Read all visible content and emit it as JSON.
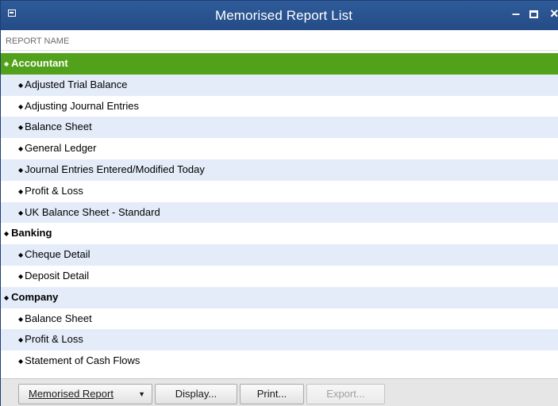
{
  "window": {
    "title": "Memorised Report List",
    "minimize_glyph": "–",
    "close_glyph": "×"
  },
  "list": {
    "column_header": "REPORT NAME",
    "groups": [
      {
        "name": "Accountant",
        "items": [
          "Adjusted Trial Balance",
          "Adjusting Journal Entries",
          "Balance Sheet",
          "General Ledger",
          "Journal Entries Entered/Modified Today",
          "Profit & Loss",
          "UK Balance Sheet - Standard"
        ]
      },
      {
        "name": "Banking",
        "items": [
          "Cheque Detail",
          "Deposit Detail"
        ]
      },
      {
        "name": "Company",
        "items": [
          "Balance Sheet",
          "Profit & Loss",
          "Statement of Cash Flows"
        ]
      }
    ],
    "bullet_glyph": "◆"
  },
  "footer": {
    "memorised_report": "Memorised Report",
    "memorised_report_arrow": "▼",
    "display": "Display...",
    "print": "Print...",
    "export": "Export..."
  },
  "colors": {
    "titlebar": "#2a5290",
    "selected_row": "#51a21a",
    "alt_row": "#e3ecf8"
  }
}
